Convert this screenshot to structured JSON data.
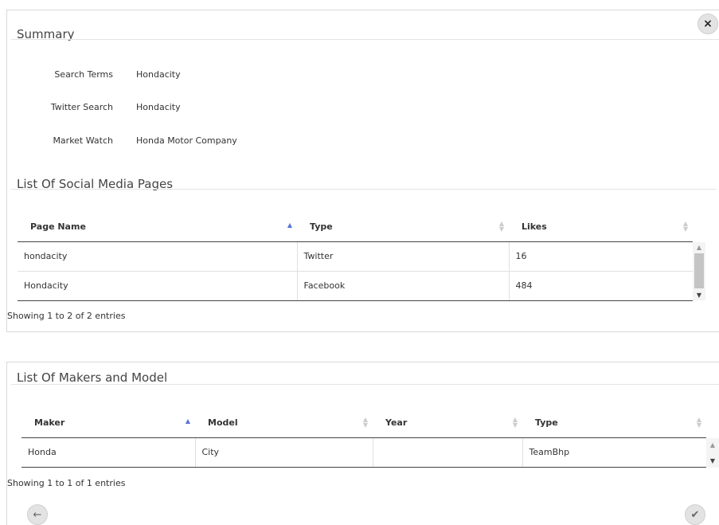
{
  "summary": {
    "title": "Summary",
    "close_icon": "×",
    "fields": [
      {
        "label": "Search Terms",
        "value": "Hondacity"
      },
      {
        "label": "Twitter Search",
        "value": "Hondacity"
      },
      {
        "label": "Market Watch",
        "value": "Honda Motor Company"
      }
    ]
  },
  "social": {
    "title": "List Of Social Media Pages",
    "columns": [
      "Page Name",
      "Type",
      "Likes"
    ],
    "rows": [
      [
        "hondacity",
        "Twitter",
        "16"
      ],
      [
        "Hondacity",
        "Facebook",
        "484"
      ]
    ],
    "info": "Showing 1 to 2 of 2 entries"
  },
  "makers": {
    "title": "List Of Makers and Model",
    "columns": [
      "Maker",
      "Model",
      "Year",
      "Type"
    ],
    "rows": [
      [
        "Honda",
        "City",
        "",
        "TeamBhp"
      ]
    ],
    "info": "Showing 1 to 1 of 1 entries"
  },
  "footer": {
    "back_icon": "←",
    "confirm_icon": "✔"
  },
  "colors": {
    "sort_active": "#5a73d8",
    "sort_inactive": "#cccccc"
  }
}
